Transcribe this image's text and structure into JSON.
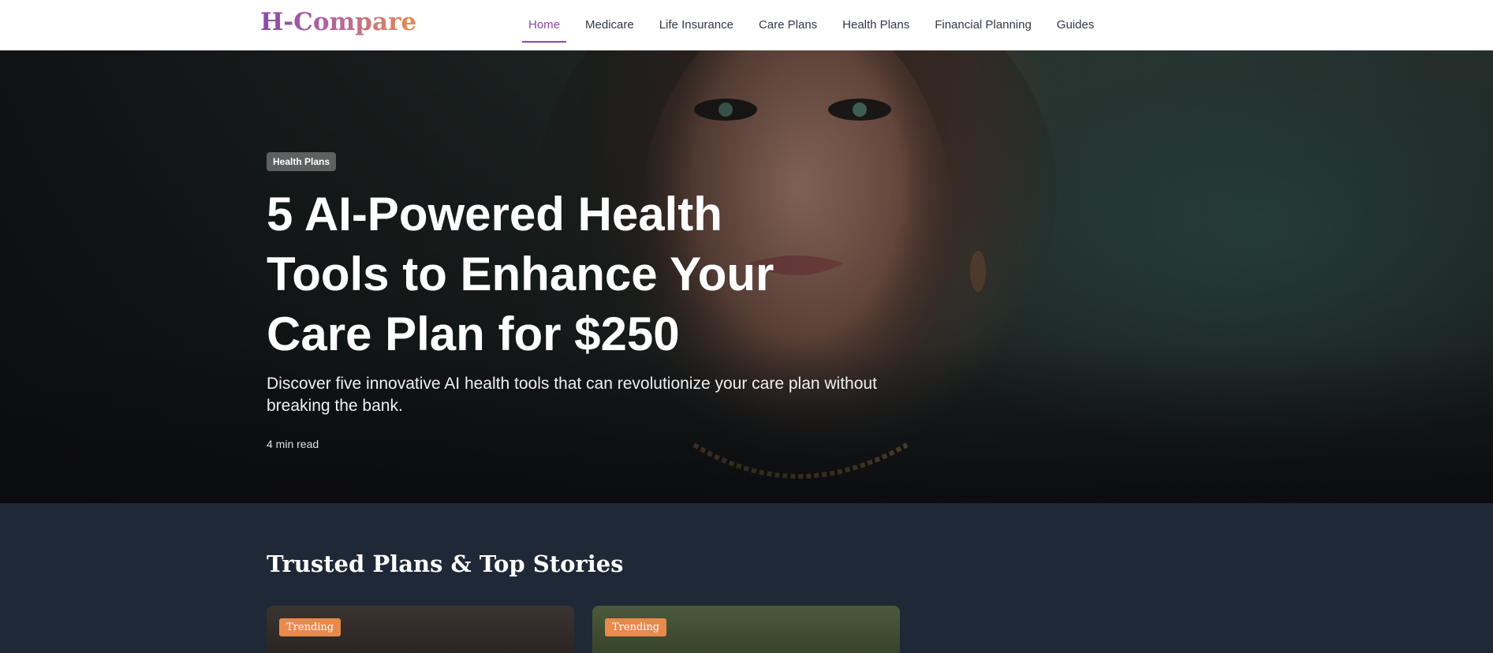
{
  "header": {
    "logo": "H-Compare",
    "nav": [
      "Home",
      "Medicare",
      "Life Insurance",
      "Care Plans",
      "Health Plans",
      "Financial Planning",
      "Guides"
    ],
    "active_nav": "Home"
  },
  "hero": {
    "tag": "Health Plans",
    "title": "5 AI-Powered Health Tools to Enhance Your Care Plan for $250",
    "description": "Discover five innovative AI health tools that can revolutionize your care plan without breaking the bank.",
    "read_time": "4 min read"
  },
  "section": {
    "title": "Trusted Plans & Top Stories",
    "cards": [
      {
        "badge": "Trending"
      },
      {
        "badge": "Trending"
      }
    ]
  },
  "colors": {
    "brand_purple": "#8b4aa8",
    "brand_orange": "#e88a4c",
    "section_bg": "#1f2837"
  }
}
